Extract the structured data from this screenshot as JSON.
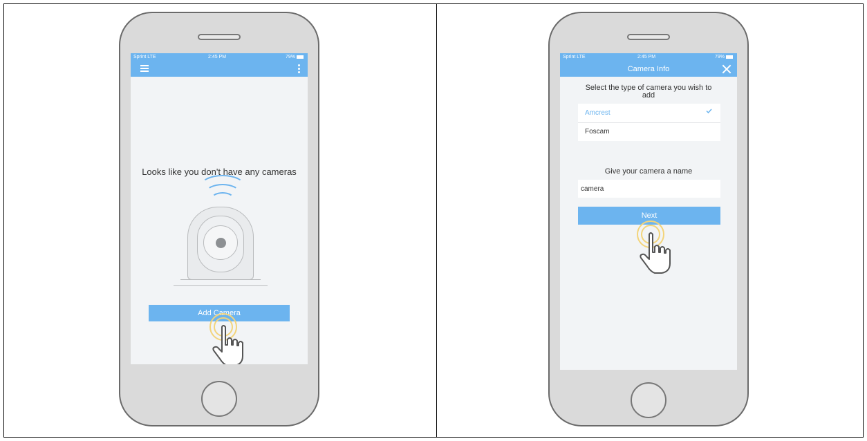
{
  "left_phone": {
    "status": {
      "carrier": "Sprint  LTE",
      "time": "2:45 PM",
      "battery": "79%"
    },
    "toolbar": {
      "menu_icon": "hamburger-menu-icon",
      "more_icon": "more-vertical-icon"
    },
    "empty_message": "Looks like you don't have any cameras",
    "illustration_icon": "ptz-camera-icon",
    "add_button_label": "Add Camera",
    "gesture_icon": "tap-hand-icon"
  },
  "right_phone": {
    "status": {
      "carrier": "Sprint  LTE",
      "time": "2:45 PM",
      "battery": "79%"
    },
    "header_title": "Camera Info",
    "close_icon": "close-icon",
    "type_prompt": "Select the type of camera you wish to add",
    "camera_types": [
      {
        "label": "Amcrest",
        "selected": true
      },
      {
        "label": "Foscam",
        "selected": false
      }
    ],
    "name_prompt": "Give your camera a name",
    "name_value": "camera",
    "next_button_label": "Next",
    "gesture_icon": "tap-hand-icon"
  },
  "colors": {
    "accent": "#6cb4ef",
    "ripple": "#f3d47a",
    "phone_body": "#dadada"
  }
}
